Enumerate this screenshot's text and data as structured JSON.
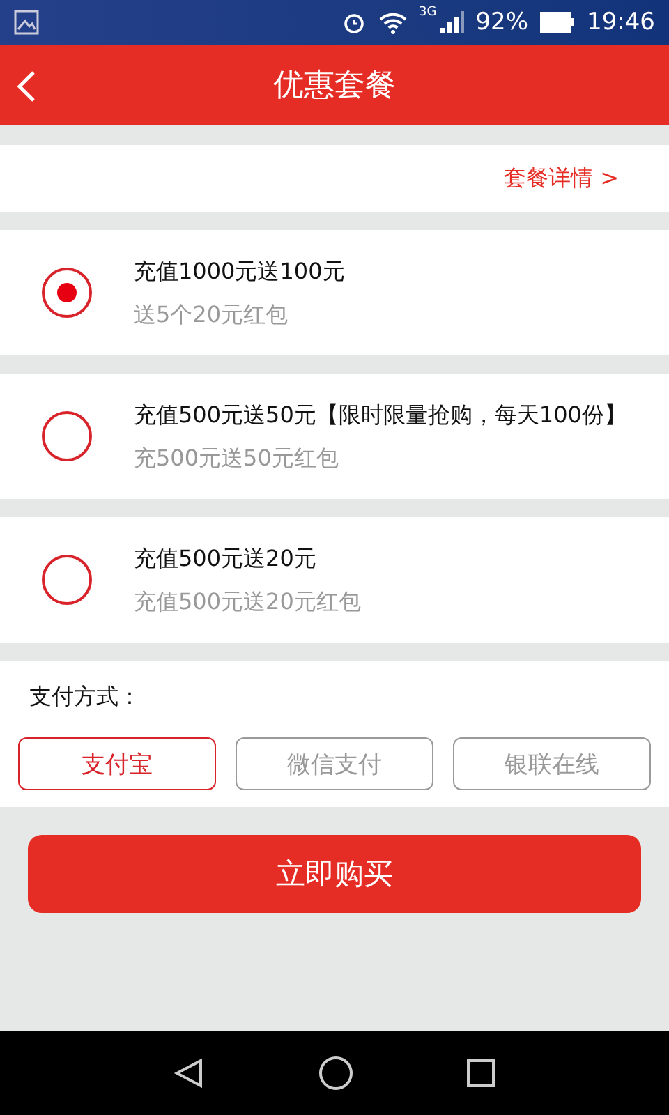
{
  "status_bar": {
    "network": "3G",
    "battery": "92%",
    "time": "19:46"
  },
  "header": {
    "title": "优惠套餐"
  },
  "details_link": "套餐详情 >",
  "packages": [
    {
      "title": "充值1000元送100元",
      "subtitle": "送5个20元红包",
      "selected": true
    },
    {
      "title": "充值500元送50元【限时限量抢购，每天100份】",
      "subtitle": "充500元送50元红包",
      "selected": false
    },
    {
      "title": "充值500元送20元",
      "subtitle": "充值500元送20元红包",
      "selected": false
    }
  ],
  "payment": {
    "label": "支付方式：",
    "methods": [
      {
        "label": "支付宝",
        "selected": true
      },
      {
        "label": "微信支付",
        "selected": false
      },
      {
        "label": "银联在线",
        "selected": false
      }
    ]
  },
  "buy_button": "立即购买"
}
